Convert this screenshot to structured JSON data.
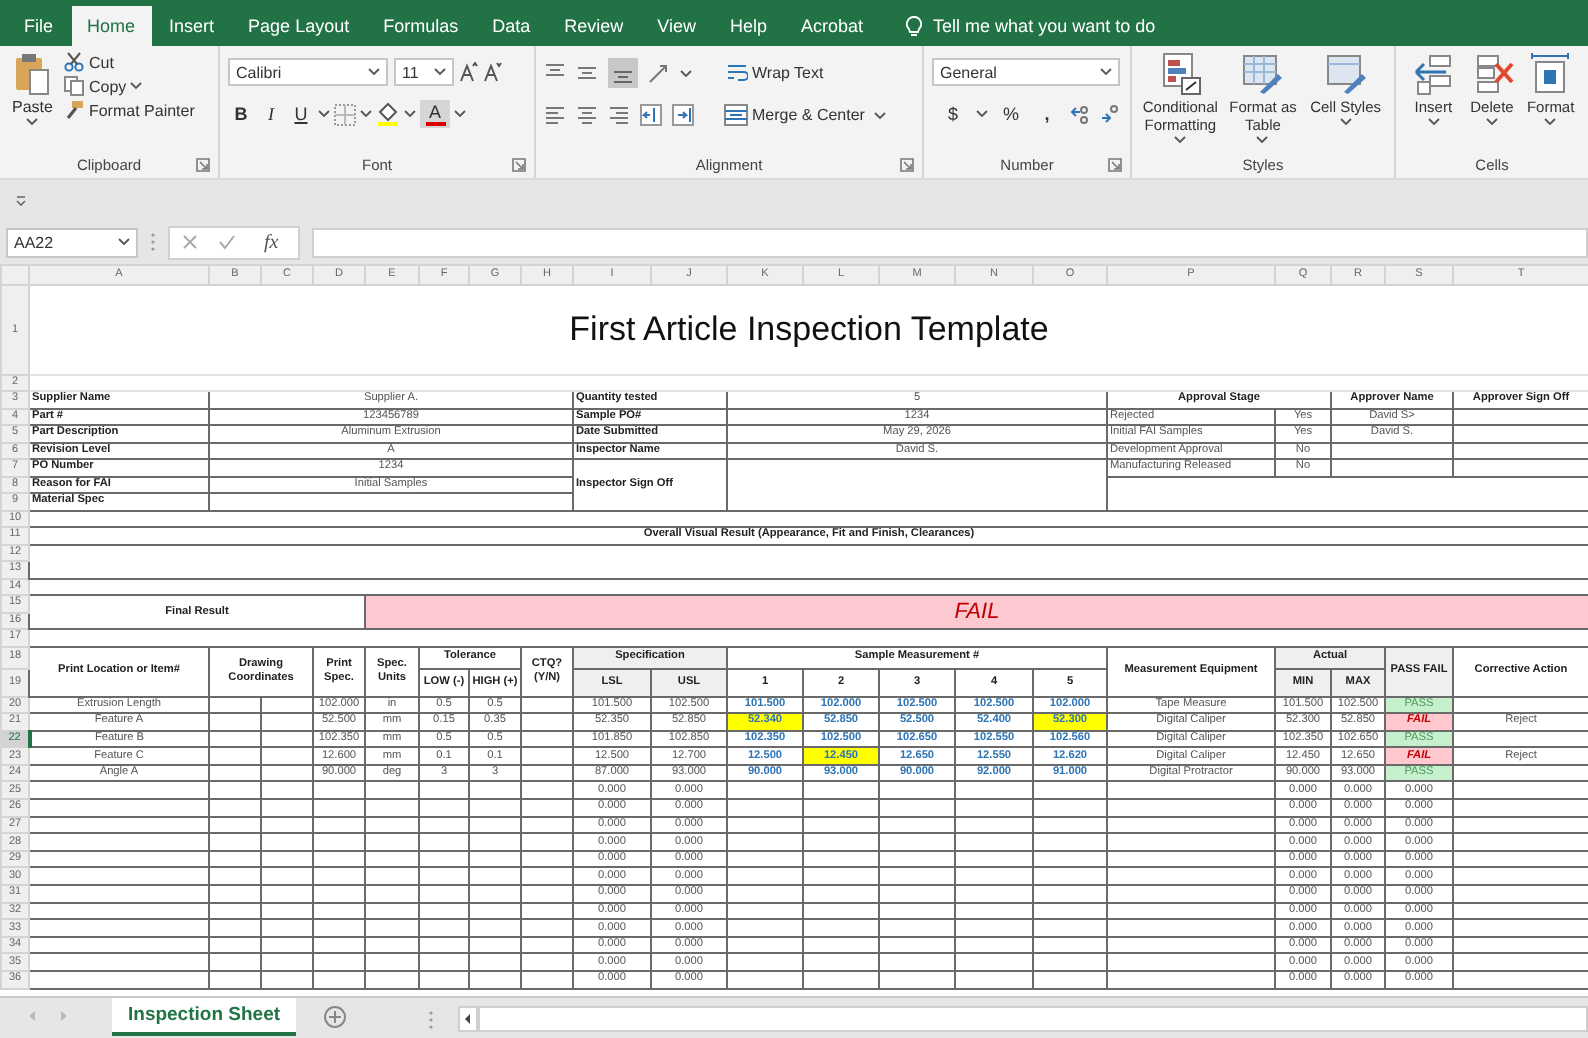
{
  "ribbon": {
    "tabs": [
      {
        "label": "File",
        "selected": false
      },
      {
        "label": "Home",
        "selected": true
      },
      {
        "label": "Insert",
        "selected": false
      },
      {
        "label": "Page Layout",
        "selected": false
      },
      {
        "label": "Formulas",
        "selected": false
      },
      {
        "label": "Data",
        "selected": false
      },
      {
        "label": "Review",
        "selected": false
      },
      {
        "label": "View",
        "selected": false
      },
      {
        "label": "Help",
        "selected": false
      },
      {
        "label": "Acrobat",
        "selected": false
      }
    ],
    "tell_me": "Tell me what you want to do",
    "clipboard": {
      "paste": "Paste",
      "cut": "Cut",
      "copy": "Copy",
      "format_painter": "Format Painter",
      "label": "Clipboard"
    },
    "font": {
      "name": "Calibri",
      "size": "11",
      "bold": "B",
      "italic": "I",
      "underline": "U",
      "color_letter": "A",
      "label": "Font"
    },
    "alignment": {
      "wrap_text": "Wrap Text",
      "merge": "Merge & Center",
      "label": "Alignment"
    },
    "number": {
      "format": "General",
      "currency": "$",
      "percent": "%",
      "comma": ",",
      "label": "Number"
    },
    "styles": {
      "buttons": [
        {
          "label": "Conditional Formatting",
          "kind": "conditional"
        },
        {
          "label": "Format as Table",
          "kind": "table"
        },
        {
          "label": "Cell Styles",
          "kind": "cellstyles"
        }
      ],
      "label": "Styles"
    },
    "cells": {
      "buttons": [
        {
          "label": "Insert",
          "kind": "insert"
        },
        {
          "label": "Delete",
          "kind": "delete"
        },
        {
          "label": "Format",
          "kind": "format"
        }
      ],
      "label": "Cells"
    }
  },
  "formula_bar": {
    "name_box": "AA22",
    "function_label": "fx"
  },
  "sheet": {
    "columns": [
      "A",
      "B",
      "C",
      "D",
      "E",
      "F",
      "G",
      "H",
      "I",
      "J",
      "K",
      "L",
      "M",
      "N",
      "O",
      "P",
      "Q",
      "R",
      "S",
      "T"
    ],
    "row_numbers": [
      {
        "label": "1",
        "selected": false
      },
      {
        "label": "2",
        "selected": false
      },
      {
        "label": "3",
        "selected": false
      },
      {
        "label": "4",
        "selected": false
      },
      {
        "label": "5",
        "selected": false
      },
      {
        "label": "6",
        "selected": false
      },
      {
        "label": "7",
        "selected": false
      },
      {
        "label": "8",
        "selected": false
      },
      {
        "label": "9",
        "selected": false
      },
      {
        "label": "10",
        "selected": false
      },
      {
        "label": "11",
        "selected": false
      },
      {
        "label": "12",
        "selected": false
      },
      {
        "label": "13",
        "selected": false
      },
      {
        "label": "14",
        "selected": false
      },
      {
        "label": "15",
        "selected": false
      },
      {
        "label": "16",
        "selected": false
      },
      {
        "label": "17",
        "selected": false
      },
      {
        "label": "18",
        "selected": false
      },
      {
        "label": "19",
        "selected": false
      },
      {
        "label": "20",
        "selected": false
      },
      {
        "label": "21",
        "selected": false
      },
      {
        "label": "22",
        "selected": true
      },
      {
        "label": "23",
        "selected": false
      },
      {
        "label": "24",
        "selected": false
      },
      {
        "label": "25",
        "selected": false
      },
      {
        "label": "26",
        "selected": false
      },
      {
        "label": "27",
        "selected": false
      },
      {
        "label": "28",
        "selected": false
      },
      {
        "label": "29",
        "selected": false
      },
      {
        "label": "30",
        "selected": false
      },
      {
        "label": "31",
        "selected": false
      },
      {
        "label": "32",
        "selected": false
      },
      {
        "label": "33",
        "selected": false
      },
      {
        "label": "34",
        "selected": false
      },
      {
        "label": "35",
        "selected": false
      },
      {
        "label": "36",
        "selected": false
      }
    ],
    "title": "First Article Inspection Template",
    "info": [
      {
        "label": "Supplier Name",
        "value": "Supplier A."
      },
      {
        "label": "Part #",
        "value": "123456789"
      },
      {
        "label": "Part Description",
        "value": "Aluminum Extrusion"
      },
      {
        "label": "Revision Level",
        "value": "A"
      },
      {
        "label": "PO Number",
        "value": "1234"
      },
      {
        "label": "Reason for FAI",
        "value": "Initial Samples"
      },
      {
        "label": "Material Spec"
      }
    ],
    "info_right": [
      {
        "label": "Quantity tested",
        "value": "5"
      },
      {
        "label": "Sample PO#",
        "value": "1234"
      },
      {
        "label": "Date Submitted",
        "value": "May 29, 2026"
      },
      {
        "label": "Inspector Name",
        "value": "David S."
      },
      {
        "label": "Inspector Sign Off"
      }
    ],
    "approval": {
      "headers": [
        "Approval Stage",
        "Approver Name",
        "Approver Sign Off"
      ],
      "rows": [
        {
          "stage": "Rejected",
          "answer": "Yes",
          "approver": "David S>"
        },
        {
          "stage": "Initial FAI Samples",
          "answer": "Yes",
          "approver": "David S."
        },
        {
          "stage": "Development Approval",
          "answer": "No"
        },
        {
          "stage": "Manufacturing Released",
          "answer": "No"
        }
      ]
    },
    "visual_result": "Overall Visual  Result (Appearance, Fit and Finish, Clearances)",
    "final_result": {
      "label": "Final Result",
      "value": "FAIL",
      "passed": false
    },
    "headers": {
      "item": "Print Location or Item#",
      "coordinates": "Drawing Coordinates",
      "spec": "Print Spec.",
      "units": "Spec. Units",
      "tolerance": "Tolerance",
      "low": "LOW (-)",
      "high": "HIGH (+)",
      "ctq": "CTQ? (Y/N)",
      "specification": "Specification",
      "lsl": "LSL",
      "usl": "USL",
      "sample": "Sample Measurement #",
      "sample_numbers": [
        "1",
        "2",
        "3",
        "4",
        "5"
      ],
      "equipment": "Measurement Equipment",
      "actual": "Actual",
      "min": "MIN",
      "max": "MAX",
      "pass_fail": "PASS FAIL",
      "action": "Corrective Action"
    },
    "measurements": [
      {
        "item": "Extrusion Length",
        "spec": "102.000",
        "units": "in",
        "low": "0.5",
        "high": "0.5",
        "lsl": "101.500",
        "usl": "102.500",
        "samples": [
          {
            "value": "101.500",
            "flagged": false
          },
          {
            "value": "102.000",
            "flagged": false
          },
          {
            "value": "102.500",
            "flagged": false
          },
          {
            "value": "102.500",
            "flagged": false
          },
          {
            "value": "102.000",
            "flagged": false
          }
        ],
        "equipment": "Tape Measure",
        "min": "101.500",
        "max": "102.500",
        "result": "PASS",
        "passed": true
      },
      {
        "item": "Feature A",
        "spec": "52.500",
        "units": "mm",
        "low": "0.15",
        "high": "0.35",
        "lsl": "52.350",
        "usl": "52.850",
        "samples": [
          {
            "value": "52.340",
            "flagged": true
          },
          {
            "value": "52.850",
            "flagged": false
          },
          {
            "value": "52.500",
            "flagged": false
          },
          {
            "value": "52.400",
            "flagged": false
          },
          {
            "value": "52.300",
            "flagged": true
          }
        ],
        "equipment": "Digital Caliper",
        "min": "52.300",
        "max": "52.850",
        "result": "FAIL",
        "passed": false,
        "action": "Reject"
      },
      {
        "item": "Feature B",
        "spec": "102.350",
        "units": "mm",
        "low": "0.5",
        "high": "0.5",
        "lsl": "101.850",
        "usl": "102.850",
        "samples": [
          {
            "value": "102.350",
            "flagged": false
          },
          {
            "value": "102.500",
            "flagged": false
          },
          {
            "value": "102.650",
            "flagged": false
          },
          {
            "value": "102.550",
            "flagged": false
          },
          {
            "value": "102.560",
            "flagged": false
          }
        ],
        "equipment": "Digital Caliper",
        "min": "102.350",
        "max": "102.650",
        "result": "PASS",
        "passed": true
      },
      {
        "item": "Feature C",
        "spec": "12.600",
        "units": "mm",
        "low": "0.1",
        "high": "0.1",
        "lsl": "12.500",
        "usl": "12.700",
        "samples": [
          {
            "value": "12.500",
            "flagged": false
          },
          {
            "value": "12.450",
            "flagged": true
          },
          {
            "value": "12.650",
            "flagged": false
          },
          {
            "value": "12.550",
            "flagged": false
          },
          {
            "value": "12.620",
            "flagged": false
          }
        ],
        "equipment": "Digital Caliper",
        "min": "12.450",
        "max": "12.650",
        "result": "FAIL",
        "passed": false,
        "action": "Reject"
      },
      {
        "item": "Angle A",
        "spec": "90.000",
        "units": "deg",
        "low": "3",
        "high": "3",
        "lsl": "87.000",
        "usl": "93.000",
        "samples": [
          {
            "value": "90.000",
            "flagged": false
          },
          {
            "value": "93.000",
            "flagged": false
          },
          {
            "value": "90.000",
            "flagged": false
          },
          {
            "value": "92.000",
            "flagged": false
          },
          {
            "value": "91.000",
            "flagged": false
          }
        ],
        "equipment": "Digital Protractor",
        "min": "90.000",
        "max": "93.000",
        "result": "PASS",
        "passed": true
      }
    ],
    "empty_rows": [
      {
        "lsl": "0.000",
        "usl": "0.000",
        "min": "0.000",
        "max": "0.000",
        "result": "0.000"
      },
      {
        "lsl": "0.000",
        "usl": "0.000",
        "min": "0.000",
        "max": "0.000",
        "result": "0.000"
      },
      {
        "lsl": "0.000",
        "usl": "0.000",
        "min": "0.000",
        "max": "0.000",
        "result": "0.000"
      },
      {
        "lsl": "0.000",
        "usl": "0.000",
        "min": "0.000",
        "max": "0.000",
        "result": "0.000"
      },
      {
        "lsl": "0.000",
        "usl": "0.000",
        "min": "0.000",
        "max": "0.000",
        "result": "0.000"
      },
      {
        "lsl": "0.000",
        "usl": "0.000",
        "min": "0.000",
        "max": "0.000",
        "result": "0.000"
      },
      {
        "lsl": "0.000",
        "usl": "0.000",
        "min": "0.000",
        "max": "0.000",
        "result": "0.000"
      },
      {
        "lsl": "0.000",
        "usl": "0.000",
        "min": "0.000",
        "max": "0.000",
        "result": "0.000"
      },
      {
        "lsl": "0.000",
        "usl": "0.000",
        "min": "0.000",
        "max": "0.000",
        "result": "0.000"
      },
      {
        "lsl": "0.000",
        "usl": "0.000",
        "min": "0.000",
        "max": "0.000",
        "result": "0.000"
      },
      {
        "lsl": "0.000",
        "usl": "0.000",
        "min": "0.000",
        "max": "0.000",
        "result": "0.000"
      },
      {
        "lsl": "0.000",
        "usl": "0.000",
        "min": "0.000",
        "max": "0.000",
        "result": "0.000"
      }
    ]
  },
  "sheet_tabs": [
    {
      "label": "Inspection Sheet",
      "selected": true
    }
  ]
}
